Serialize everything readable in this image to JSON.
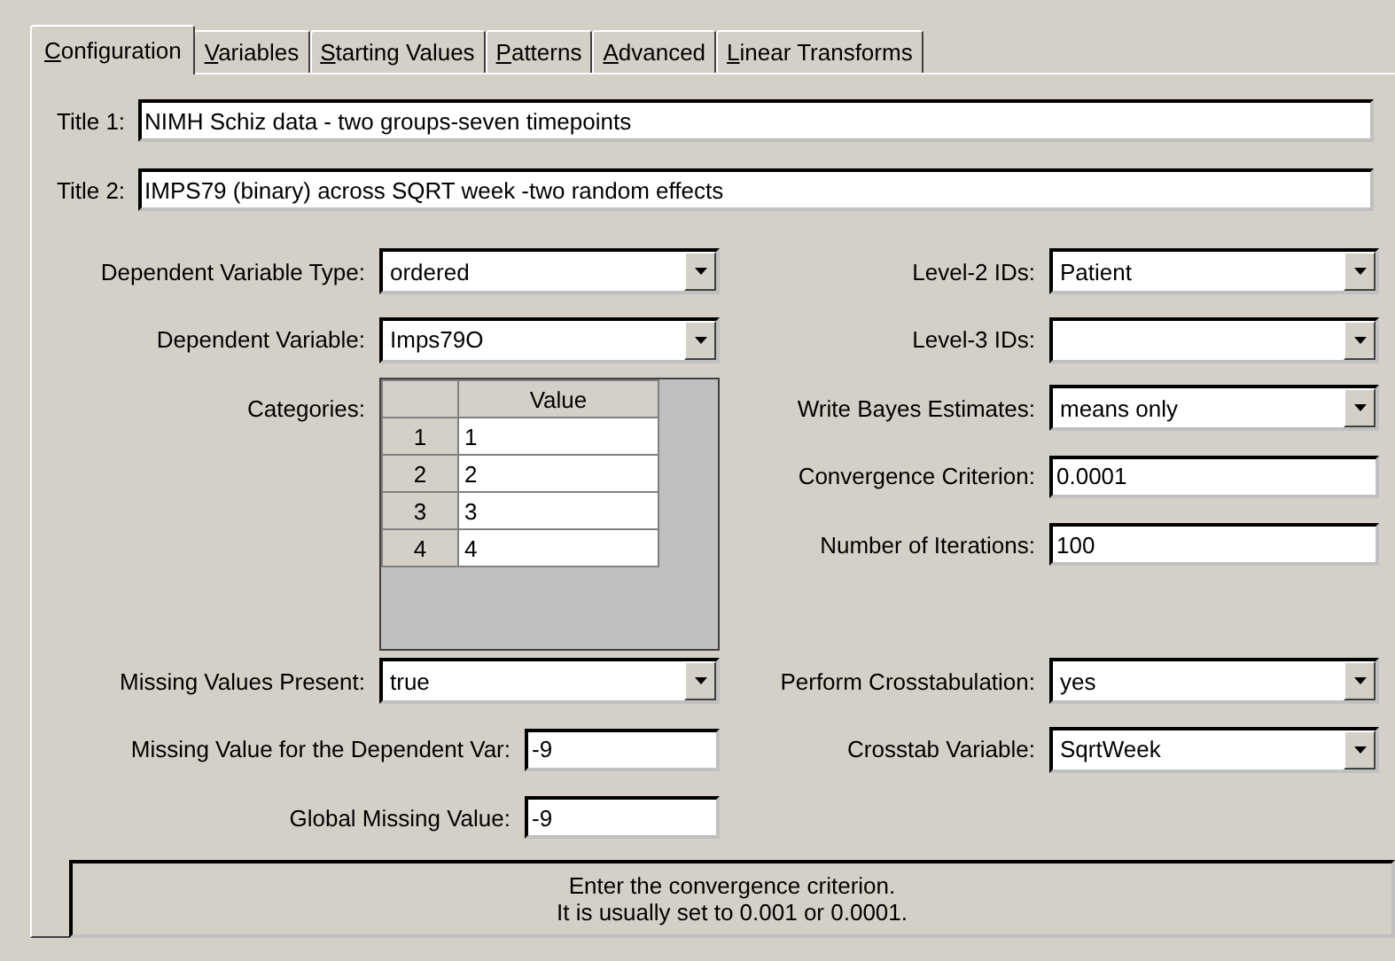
{
  "tabs": [
    {
      "label": "Configuration",
      "selected": true
    },
    {
      "label": "Variables",
      "selected": false
    },
    {
      "label": "Starting Values",
      "selected": false
    },
    {
      "label": "Patterns",
      "selected": false
    },
    {
      "label": "Advanced",
      "selected": false
    },
    {
      "label": "Linear Transforms",
      "selected": false
    }
  ],
  "titles": [
    {
      "label": "Title 1:",
      "value": "NIMH Schiz data - two groups-seven timepoints"
    },
    {
      "label": "Title 2:",
      "value": "IMPS79 (binary) across SQRT week -two random effects"
    }
  ],
  "left_fields": [
    {
      "kind": "dropdown",
      "label": "Dependent Variable Type:",
      "value": "ordered"
    },
    {
      "kind": "dropdown",
      "label": "Dependent Variable:",
      "value": "Imps79O"
    },
    {
      "kind": "grid",
      "label": "Categories:",
      "header": "Value",
      "rows": [
        {
          "number": "1",
          "value": "1"
        },
        {
          "number": "2",
          "value": "2"
        },
        {
          "number": "3",
          "value": "3"
        },
        {
          "number": "4",
          "value": "4"
        }
      ]
    },
    {
      "kind": "dropdown",
      "label": "Missing Values Present:",
      "value": "true"
    },
    {
      "kind": "text",
      "label": "Missing Value for the Dependent Var:",
      "value": "-9"
    },
    {
      "kind": "text",
      "label": "Global Missing Value:",
      "value": "-9"
    }
  ],
  "right_fields": [
    {
      "kind": "dropdown",
      "label": "Level-2 IDs:",
      "value": "Patient"
    },
    {
      "kind": "dropdown",
      "label": "Level-3 IDs:"
    },
    {
      "kind": "dropdown",
      "label": "Write Bayes Estimates:",
      "value": "means only"
    },
    {
      "kind": "text",
      "label": "Convergence Criterion:",
      "value": "0.0001"
    },
    {
      "kind": "text",
      "label": "Number of Iterations:",
      "value": "100"
    },
    {
      "kind": "spacer"
    },
    {
      "kind": "dropdown",
      "label": "Perform Crosstabulation:",
      "value": "yes"
    },
    {
      "kind": "dropdown",
      "label": "Crosstab Variable:",
      "value": "SqrtWeek"
    }
  ],
  "status_lines": [
    "Enter the convergence criterion.",
    "It is usually set to 0.001 or 0.0001."
  ]
}
